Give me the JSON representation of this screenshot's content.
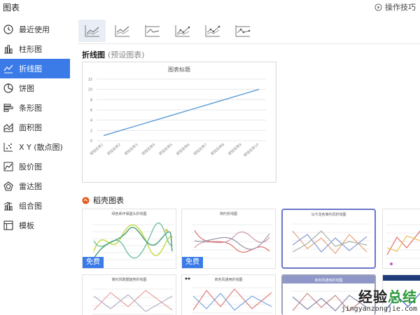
{
  "dialog": {
    "title": "图表",
    "help_label": "操作技巧"
  },
  "sidebar": {
    "items": [
      {
        "label": "最近使用",
        "icon": "clock-icon"
      },
      {
        "label": "柱形图",
        "icon": "bar-chart-icon"
      },
      {
        "label": "折线图",
        "icon": "line-chart-icon",
        "active": true
      },
      {
        "label": "饼图",
        "icon": "pie-chart-icon"
      },
      {
        "label": "条形图",
        "icon": "horizontal-bar-icon"
      },
      {
        "label": "面积图",
        "icon": "area-chart-icon"
      },
      {
        "label": "X Y (散点图)",
        "icon": "scatter-icon"
      },
      {
        "label": "股价图",
        "icon": "stock-chart-icon"
      },
      {
        "label": "雷达图",
        "icon": "radar-chart-icon"
      },
      {
        "label": "组合图",
        "icon": "combo-chart-icon"
      },
      {
        "label": "模板",
        "icon": "template-icon"
      }
    ]
  },
  "section": {
    "title": "折线图",
    "note": "(预设图表)"
  },
  "preview": {
    "chart_data": {
      "type": "line",
      "title": "图表标题",
      "categories": [
        "按钮名称1",
        "按钮名称2",
        "按钮名称3",
        "按钮名称4",
        "按钮名称5",
        "按钮名称6",
        "按钮名称7",
        "按钮名称8",
        "按钮名称9",
        "按钮名称10"
      ],
      "values": [
        1,
        2,
        3,
        4,
        5,
        6,
        7,
        8,
        9,
        10
      ],
      "ylim": [
        0,
        12
      ],
      "yticks": [
        0,
        2,
        4,
        6,
        8,
        10,
        12
      ],
      "grid": true,
      "line_color": "#5b9bd5"
    }
  },
  "templates": {
    "header": "稻壳图表",
    "free_label": "免费",
    "cards": [
      {
        "title": "绿色系环保圆头折线图",
        "free": true
      },
      {
        "title": "简约折线图",
        "free": true
      },
      {
        "title": "马卡龙色简约风折线图",
        "free": false
      },
      {
        "title": "",
        "free": false
      },
      {
        "title": "简约风数据趋势折线图",
        "free": false
      },
      {
        "title": "商务风通用折线图",
        "free": false
      },
      {
        "title": "商务风通用折线图",
        "free": false
      },
      {
        "title": "",
        "free": false
      }
    ]
  },
  "watermark": {
    "main_left": "经验",
    "main_right": "总结",
    "sub": "jingyanzongjie.com"
  },
  "colors": {
    "accent": "#3b7be8",
    "line": "#5b9bd5"
  }
}
